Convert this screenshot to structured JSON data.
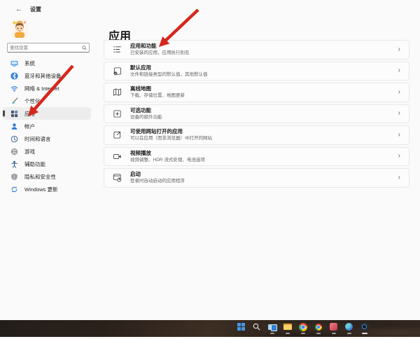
{
  "window": {
    "title": "设置"
  },
  "icons": {
    "back": "←",
    "chevron": "›"
  },
  "search": {
    "placeholder": "查找设置"
  },
  "sidebar": {
    "items": [
      {
        "label": "系统",
        "icon": "system-icon",
        "selected": false
      },
      {
        "label": "蓝牙和其他设备",
        "icon": "bluetooth-icon",
        "selected": false
      },
      {
        "label": "网络 & Internet",
        "icon": "network-icon",
        "selected": false
      },
      {
        "label": "个性化",
        "icon": "personalization-icon",
        "selected": false
      },
      {
        "label": "应用",
        "icon": "apps-icon",
        "selected": true
      },
      {
        "label": "帐户",
        "icon": "accounts-icon",
        "selected": false
      },
      {
        "label": "时间和语言",
        "icon": "time-language-icon",
        "selected": false
      },
      {
        "label": "游戏",
        "icon": "gaming-icon",
        "selected": false
      },
      {
        "label": "辅助功能",
        "icon": "accessibility-icon",
        "selected": false
      },
      {
        "label": "隐私和安全性",
        "icon": "privacy-icon",
        "selected": false
      },
      {
        "label": "Windows 更新",
        "icon": "windows-update-icon",
        "selected": false
      }
    ]
  },
  "main": {
    "title": "应用",
    "items": [
      {
        "title": "应用和功能",
        "subtitle": "已安装的应用，应用执行别名"
      },
      {
        "title": "默认应用",
        "subtitle": "文件和链接类型的默认值，其他默认值"
      },
      {
        "title": "离线地图",
        "subtitle": "下载、存储位置、地图更新"
      },
      {
        "title": "可选功能",
        "subtitle": "设备的额外功能"
      },
      {
        "title": "可使用网站打开的应用",
        "subtitle": "可以在应用（而非浏览器）中打开的网站"
      },
      {
        "title": "视频播放",
        "subtitle": "视频调整、HDR 流式处理、电池选项"
      },
      {
        "title": "启动",
        "subtitle": "登录时自动启动的应用程序"
      }
    ]
  },
  "annotations": {
    "arrow_color": "#d6271c",
    "arrow_1_target": "应用和功能",
    "arrow_2_target": "应用"
  },
  "taskbar": {
    "icons": [
      "start",
      "search",
      "task-view",
      "file-explorer",
      "chrome",
      "browser",
      "pink-app",
      "globe-app",
      "capture-app"
    ]
  },
  "colors": {
    "window_bg": "#fafafa",
    "card_bg": "#fcfcfc",
    "nav_selected_bg": "#ededed",
    "accent_bar": "#484848",
    "taskbar_bg": "#2a211b"
  }
}
